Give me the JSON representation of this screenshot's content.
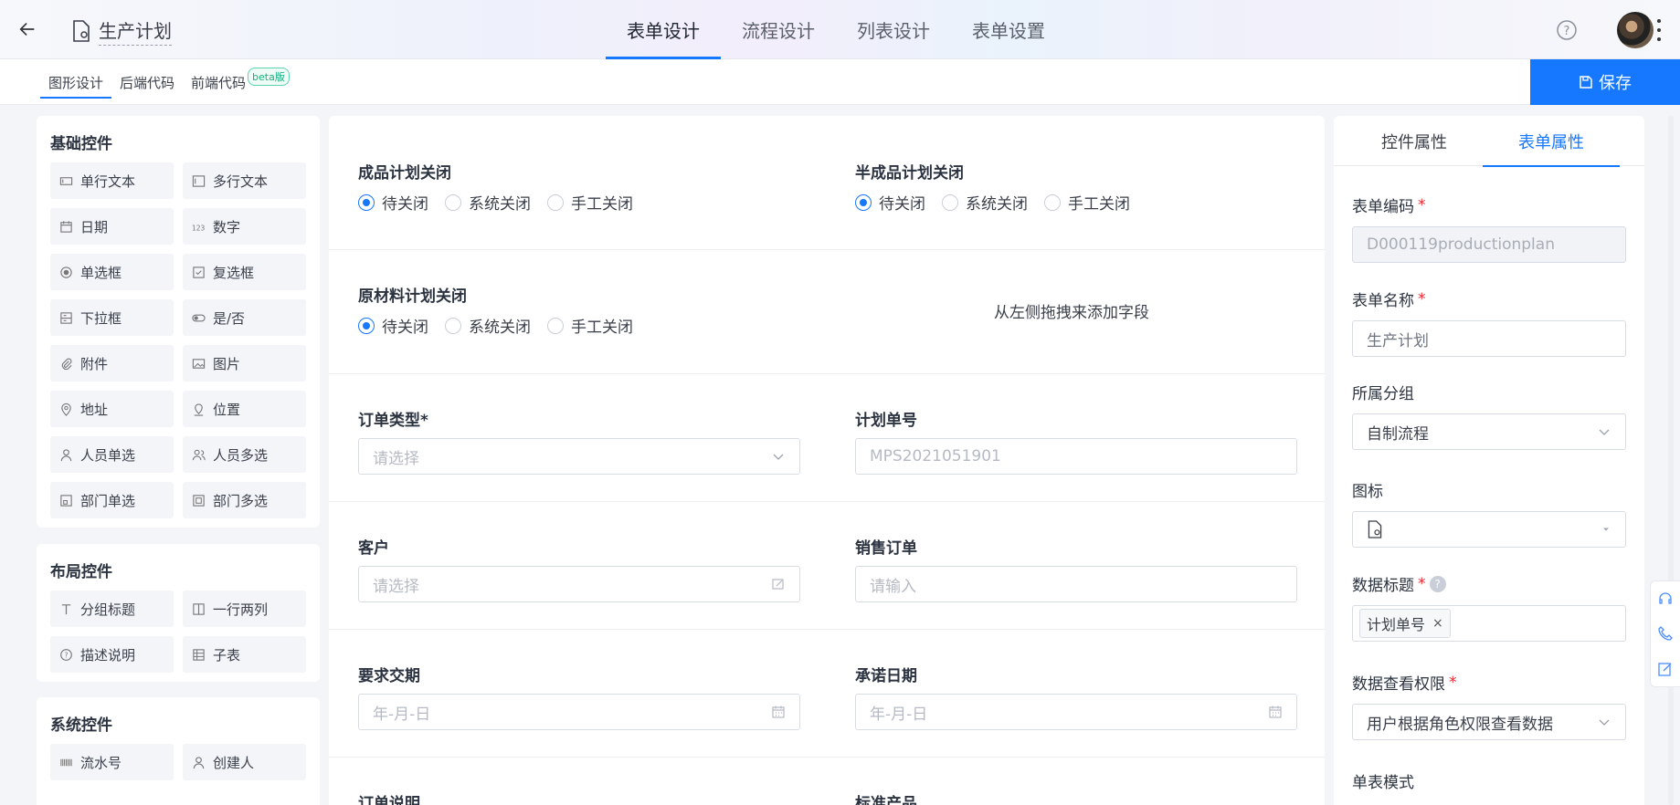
{
  "header": {
    "title": "生产计划",
    "tabs": [
      "表单设计",
      "流程设计",
      "列表设计",
      "表单设置"
    ]
  },
  "subbar": {
    "tabs": [
      "图形设计",
      "后端代码",
      "前端代码"
    ],
    "beta": "beta版",
    "save": "保存"
  },
  "palette": {
    "basic_title": "基础控件",
    "basic": [
      "单行文本",
      "多行文本",
      "日期",
      "数字",
      "单选框",
      "复选框",
      "下拉框",
      "是/否",
      "附件",
      "图片",
      "地址",
      "位置",
      "人员单选",
      "人员多选",
      "部门单选",
      "部门多选"
    ],
    "layout_title": "布局控件",
    "layout": [
      "分组标题",
      "一行两列",
      "描述说明",
      "子表"
    ],
    "system_title": "系统控件",
    "system": [
      "流水号",
      "创建人"
    ]
  },
  "form": {
    "radio_options": [
      "待关闭",
      "系统关闭",
      "手工关闭"
    ],
    "finished_close": "成品计划关闭",
    "semi_close": "半成品计划关闭",
    "raw_close": "原材料计划关闭",
    "dropzone": "从左侧拖拽来添加字段",
    "order_type_label": "订单类型*",
    "order_type_placeholder": "请选择",
    "plan_no_label": "计划单号",
    "plan_no_value": "MPS2021051901",
    "customer_label": "客户",
    "customer_placeholder": "请选择",
    "sales_order_label": "销售订单",
    "sales_order_placeholder": "请输入",
    "due_label": "要求交期",
    "due_placeholder": "年-月-日",
    "promise_label": "承诺日期",
    "promise_placeholder": "年-月-日",
    "order_note_label": "订单说明",
    "std_product_label": "标准产品"
  },
  "props": {
    "tabs": [
      "控件属性",
      "表单属性"
    ],
    "code_label": "表单编码",
    "code_value": "D000119productionplan",
    "name_label": "表单名称",
    "name_value": "生产计划",
    "group_label": "所属分组",
    "group_value": "自制流程",
    "icon_label": "图标",
    "data_title_label": "数据标题",
    "data_title_tag": "计划单号",
    "perm_label": "数据查看权限",
    "perm_value": "用户根据角色权限查看数据",
    "mode_label": "单表模式",
    "required_mark": "*",
    "help_mark": "?"
  },
  "colors": {
    "accent": "#1677ff",
    "required": "#f5222d",
    "beta": "#19b07f"
  }
}
